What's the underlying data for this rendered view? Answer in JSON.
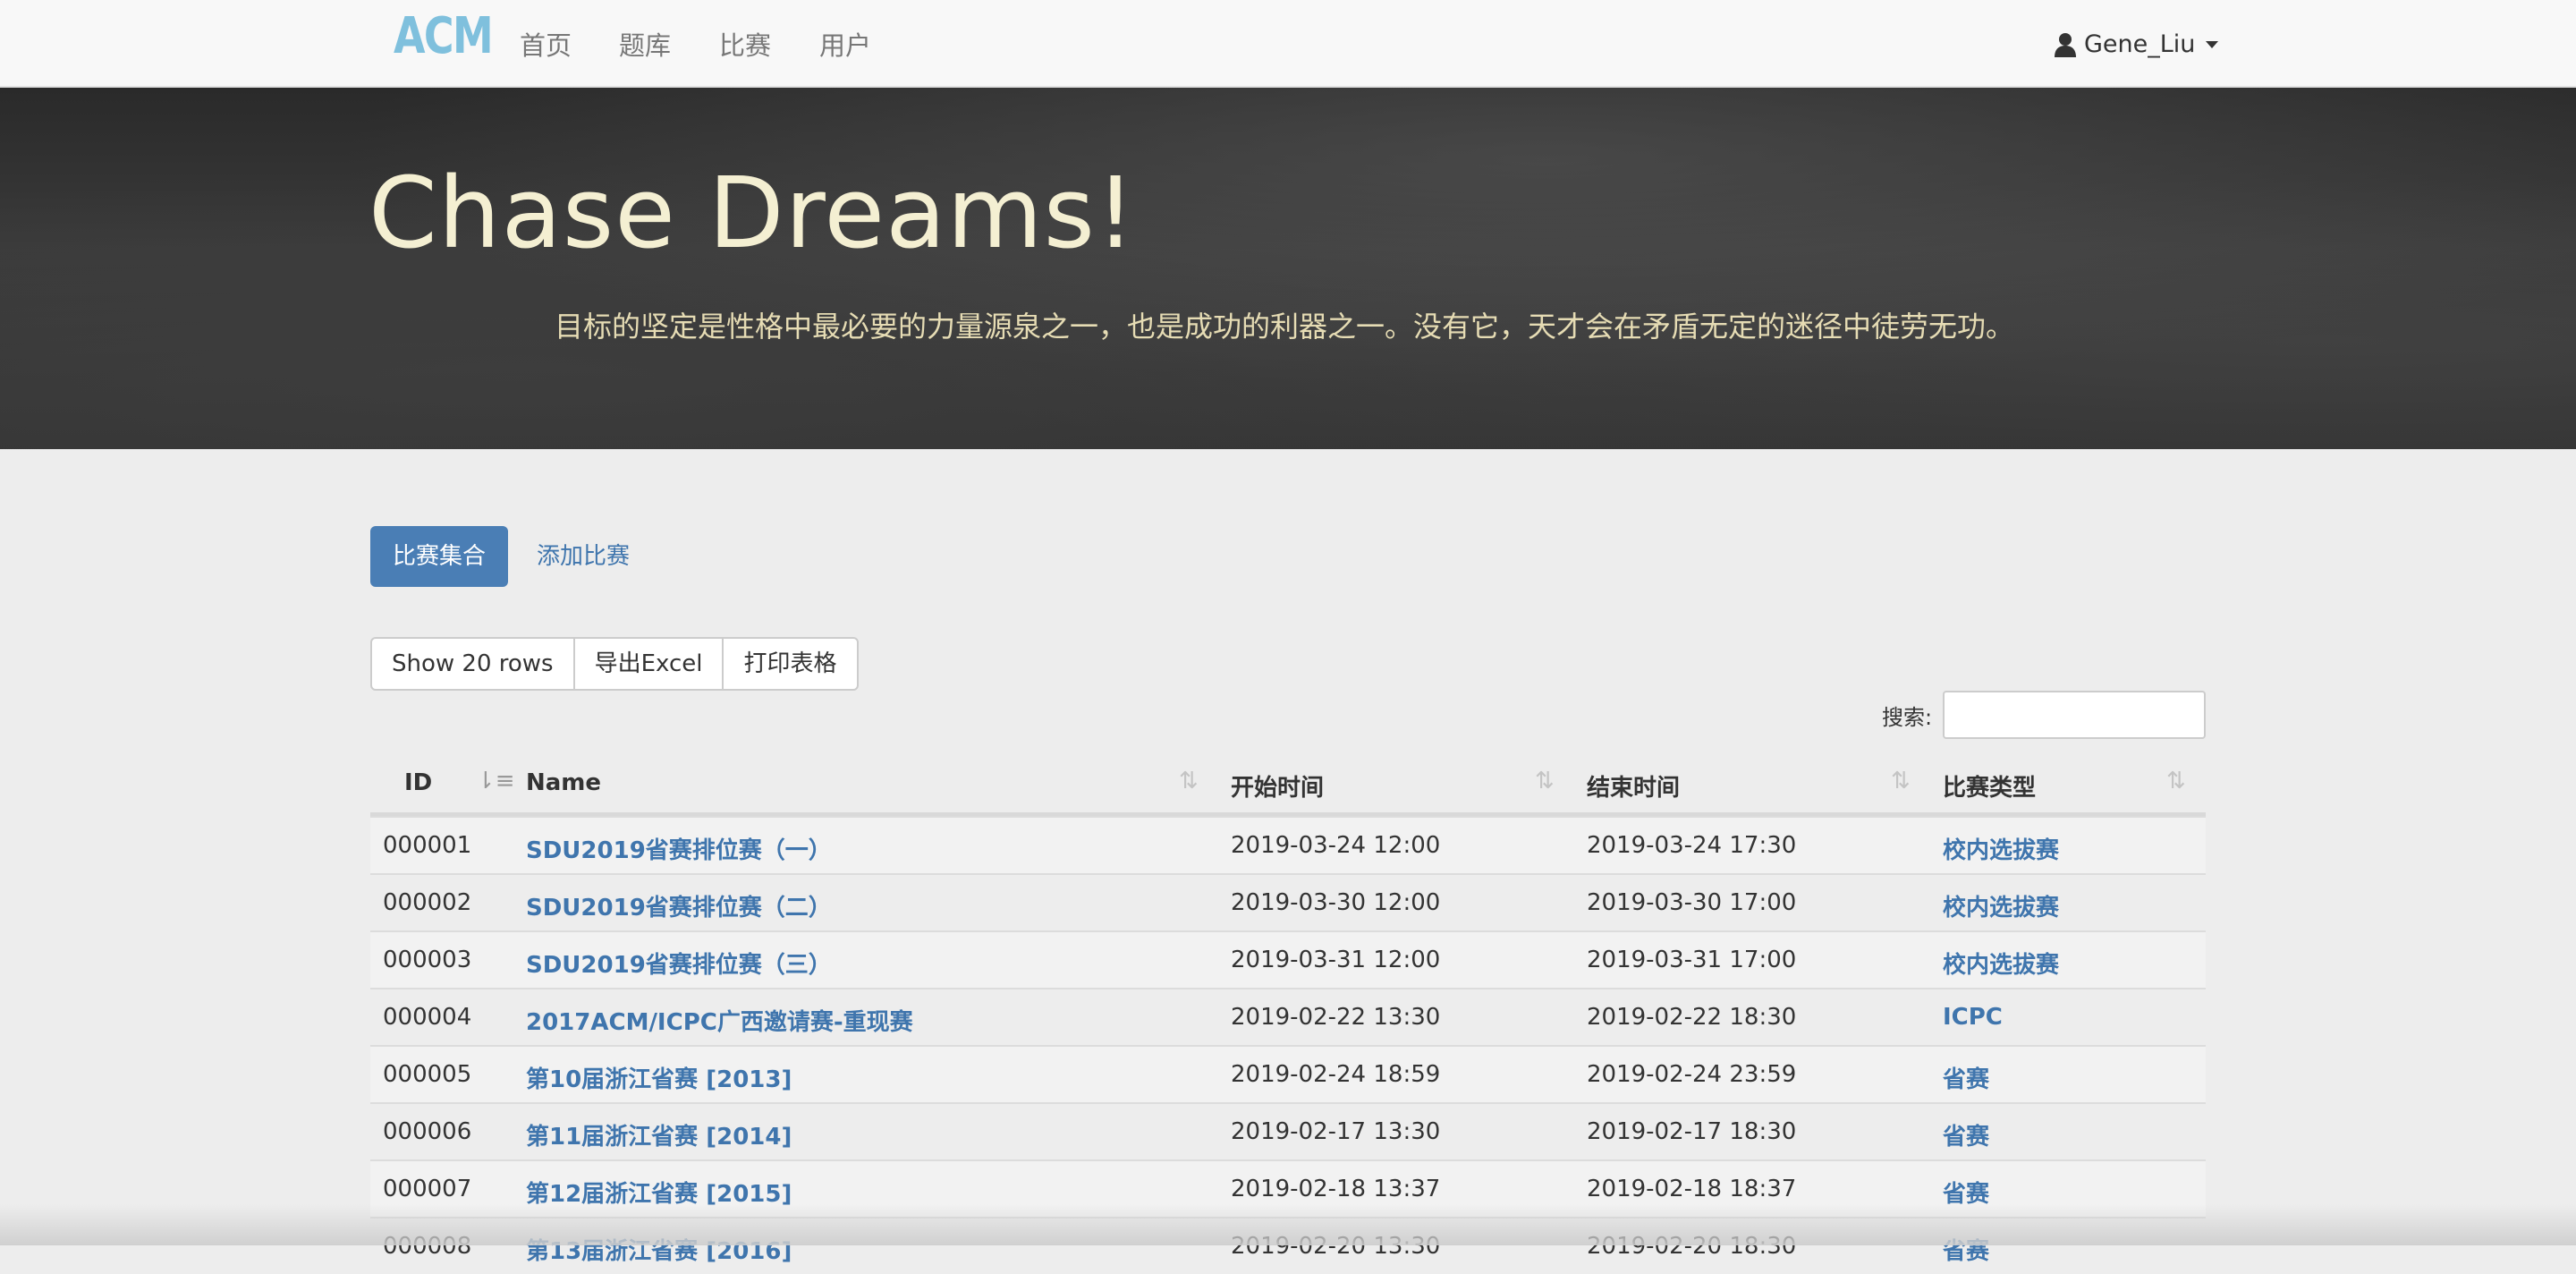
{
  "navbar": {
    "brand": "ACM",
    "items": [
      {
        "label": "首页"
      },
      {
        "label": "题库"
      },
      {
        "label": "比赛"
      },
      {
        "label": "用户"
      }
    ],
    "user": "Gene_Liu"
  },
  "hero": {
    "title": "Chase Dreams!",
    "subtitle": "目标的坚定是性格中最必要的力量源泉之一，也是成功的利器之一。没有它，天才会在矛盾无定的迷径中徒劳无功。"
  },
  "tabs": {
    "active": "比赛集合",
    "link": "添加比赛"
  },
  "toolbar": {
    "show_rows": "Show 20 rows",
    "export": "导出Excel",
    "print": "打印表格"
  },
  "search": {
    "label": "搜索:",
    "value": ""
  },
  "table": {
    "headers": {
      "id": "ID",
      "name": "Name",
      "start": "开始时间",
      "end": "结束时间",
      "type": "比赛类型"
    },
    "rows": [
      {
        "id": "000001",
        "name": "SDU2019省赛排位赛（一）",
        "start": "2019-03-24 12:00",
        "end": "2019-03-24 17:30",
        "type": "校内选拔赛"
      },
      {
        "id": "000002",
        "name": "SDU2019省赛排位赛（二）",
        "start": "2019-03-30 12:00",
        "end": "2019-03-30 17:00",
        "type": "校内选拔赛"
      },
      {
        "id": "000003",
        "name": "SDU2019省赛排位赛（三）",
        "start": "2019-03-31 12:00",
        "end": "2019-03-31 17:00",
        "type": "校内选拔赛"
      },
      {
        "id": "000004",
        "name": "2017ACM/ICPC广西邀请赛-重现赛",
        "start": "2019-02-22 13:30",
        "end": "2019-02-22 18:30",
        "type": "ICPC"
      },
      {
        "id": "000005",
        "name": "第10届浙江省赛 [2013]",
        "start": "2019-02-24 18:59",
        "end": "2019-02-24 23:59",
        "type": "省赛"
      },
      {
        "id": "000006",
        "name": "第11届浙江省赛 [2014]",
        "start": "2019-02-17 13:30",
        "end": "2019-02-17 18:30",
        "type": "省赛"
      },
      {
        "id": "000007",
        "name": "第12届浙江省赛 [2015]",
        "start": "2019-02-18 13:37",
        "end": "2019-02-18 18:37",
        "type": "省赛"
      },
      {
        "id": "000008",
        "name": "第13届浙江省赛 [2016]",
        "start": "2019-02-20 13:30",
        "end": "2019-02-20 18:30",
        "type": "省赛"
      }
    ]
  },
  "colors": {
    "brand": "#7fc0dd",
    "primary": "#4a7eb5",
    "link": "#3f75ad",
    "hero_title": "#f4efd2"
  },
  "icons": {
    "user": "user-icon",
    "sort": "sort-icon",
    "sort_active": "sort-asc-icon"
  }
}
